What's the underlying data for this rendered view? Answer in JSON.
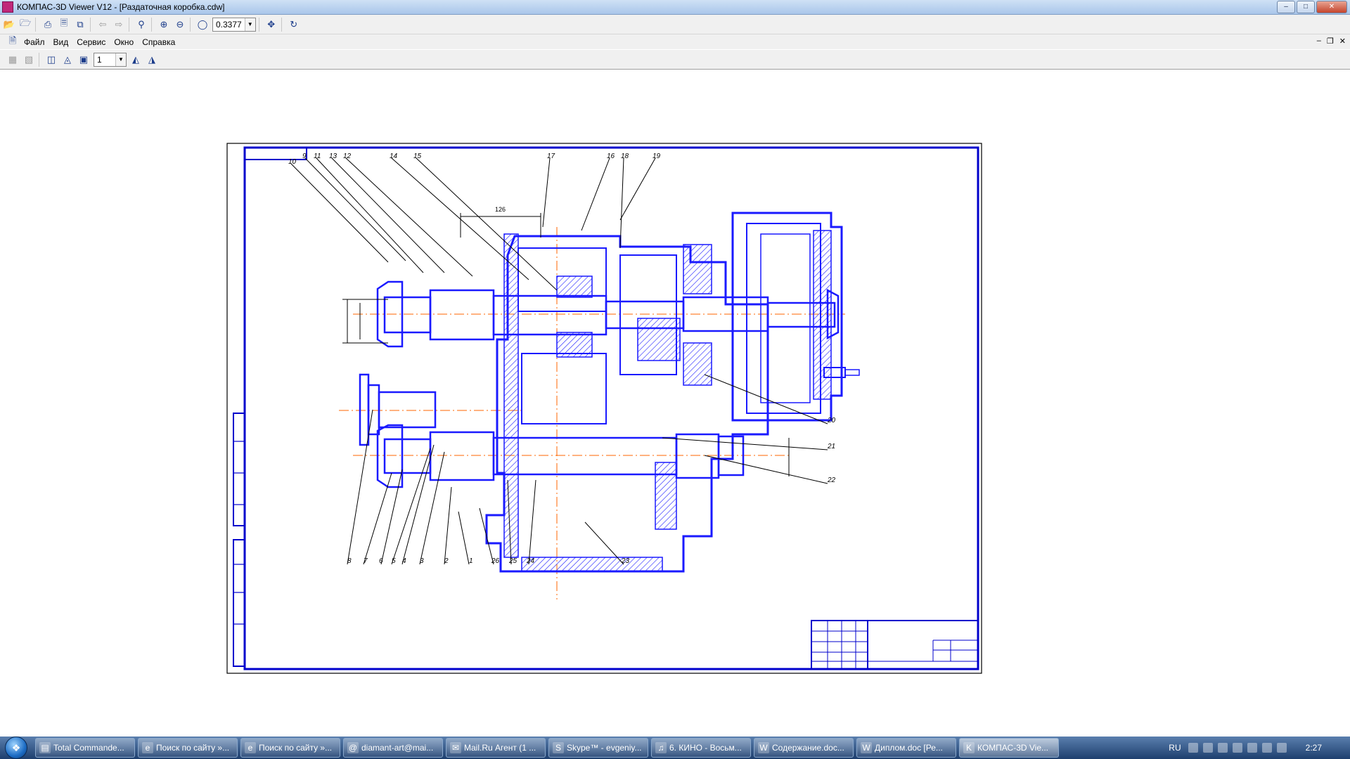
{
  "window": {
    "title": "КОМПАС-3D Viewer V12 - [Раздаточная коробка.cdw]",
    "buttons": [
      "minimize",
      "maximize",
      "close"
    ]
  },
  "toolbar_top": {
    "zoom_value": "0.3377",
    "icons": [
      "open-icon",
      "open-recent-icon",
      "print-icon",
      "print-preview-icon",
      "export-icon",
      "back-icon",
      "forward-icon",
      "zoom-frame-icon",
      "zoom-in-icon",
      "zoom-out-icon",
      "zoom-scale-icon",
      "pan-icon",
      "refresh-icon"
    ]
  },
  "menu": {
    "items": [
      "Файл",
      "Вид",
      "Сервис",
      "Окно",
      "Справка"
    ]
  },
  "toolbar_second": {
    "sheet_value": "1"
  },
  "drawing": {
    "callouts": [
      "10",
      "9",
      "11",
      "13",
      "12",
      "14",
      "15",
      "17",
      "16",
      "18",
      "19",
      "20",
      "21",
      "22",
      "23",
      "24",
      "25",
      "26",
      "8",
      "7",
      "6",
      "5",
      "4",
      "3",
      "2",
      "1"
    ],
    "dimension": "126",
    "border_color": "#0000cc",
    "line_color": "#1a1aff",
    "axis_color": "#ff6600"
  },
  "taskbar": {
    "tasks": [
      {
        "label": "Total Commande...",
        "icon": "total-commander-icon"
      },
      {
        "label": "Поиск по сайту »...",
        "icon": "ie-icon"
      },
      {
        "label": "Поиск по сайту »...",
        "icon": "ie-icon"
      },
      {
        "label": "diamant-art@mai...",
        "icon": "mail-icon"
      },
      {
        "label": "Mail.Ru Агент (1 ...",
        "icon": "mail-agent-icon"
      },
      {
        "label": "Skype™ - evgeniy...",
        "icon": "skype-icon"
      },
      {
        "label": "6. КИНО - Восьм...",
        "icon": "media-icon"
      },
      {
        "label": "Содержание.doc...",
        "icon": "word-icon"
      },
      {
        "label": "Диплом.doc [Ре...",
        "icon": "word-icon"
      },
      {
        "label": "КОМПАС-3D Vie...",
        "icon": "kompas-icon"
      }
    ],
    "lang": "RU",
    "clock": "2:27"
  }
}
